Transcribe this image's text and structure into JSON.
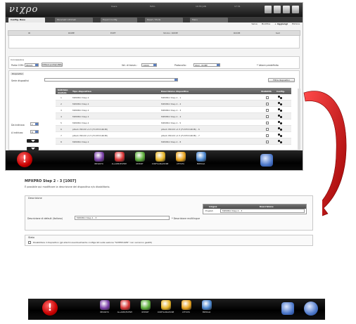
{
  "shot1": {
    "logo": "νιχρο",
    "top_info": [
      "Users",
      "Tutto",
      "19:55 JUN",
      "17:31"
    ],
    "tabs": [
      "Config. Base",
      "Parametri ottimali",
      "Export Config",
      "Reset / Mods",
      "Menu"
    ],
    "actions": [
      "Salva",
      "Modifica",
      "Aggiungi",
      "Elimina"
    ],
    "grid_head": [
      "ID",
      "ROME",
      "EXPT",
      "Strobo: ROME",
      "ROOM",
      "test"
    ],
    "connessione": {
      "title": "Connessione",
      "porta_com_label": "Porta COM:",
      "porta_com_value": "PROVA",
      "porta_button": "Ottieni porta(USB)",
      "vel_label": "Vel. di trasm.:",
      "vel_value": "19200",
      "protocollo_label": "Protocollo:",
      "protocollo_value": "IDAX - ROME",
      "hint": "* Valore predefinito"
    },
    "dispositivi": {
      "title": "Dispositivi",
      "serie_label": "Serie dispositivi",
      "filter_button": "Filtra dispositivi",
      "da_indirizzo_label": "Da indirizzo",
      "da_indirizzo_value": "1",
      "a_indirizzo_label": "A indirizzo",
      "a_indirizzo_value": "8",
      "headers": [
        "Indirizzo modulo",
        "Tipo dispositivo",
        "Descrizione dispositivo",
        "Visibilità",
        "Config."
      ],
      "rows": [
        {
          "addr": "1",
          "tipo": "MPXPRO Step 2",
          "desc": "MPXPRO Step 2 - 1"
        },
        {
          "addr": "2",
          "tipo": "MPXPRO Step 2",
          "desc": "MPXPRO Step 2 - 2"
        },
        {
          "addr": "3",
          "tipo": "MPXPRO Step 2",
          "desc": "MPXPRO Step 2 - 3"
        },
        {
          "addr": "4",
          "tipo": "MPXPRO Step 2",
          "desc": "MPXPRO Step 2 - 4"
        },
        {
          "addr": "5",
          "tipo": "MPXPRO Step 2",
          "desc": "MPXPRO Step 2 - 5"
        },
        {
          "addr": "6",
          "tipo": "pRack PR100 v1.5 (FLSTDmRCIB)",
          "desc": "pRack PR100 v1.5 (FLSTDmRCIB) - 6"
        },
        {
          "addr": "7",
          "tipo": "pRack PR100 v1.5 (FLSTDmRCIB)",
          "desc": "pRack PR100 v1.5 (FLSTDmRCIB) - 7"
        },
        {
          "addr": "8",
          "tipo": "MPXPRO Step 2",
          "desc": "MPXPRO Step 2 - 8"
        }
      ]
    },
    "dock": [
      "IMPIANTO",
      "ALLARMI/EVENTI",
      "REPORT",
      "CONFIGURAZIONE",
      "ATTIVITÀ",
      "ENERGIA"
    ],
    "alert_glyph": "!"
  },
  "shot2": {
    "title": "MPXPRO Step 2 - 3 [1007]",
    "subtitle": "È possibile qui modificare la descrizione del dispositivo e/o disabilitarlo.",
    "descrizione": {
      "legend": "Descrizione",
      "default_label": "Descrizione di default (Italiano)",
      "default_value": "MPXPRO Step 2 - 3",
      "multilingua_label": "* Descrizione multilingue",
      "table_headers": [
        "Lingua",
        "Descrizione"
      ],
      "table_row": {
        "lang": "English",
        "desc": "MPXPRO Step 2 - 3"
      }
    },
    "stato": {
      "legend": "Stato",
      "checkbox_label": "Disabilitare il dispositivo (gli allarmi eventualmente configurati sulla sezione \"SCHEDULER\" non verranno gestiti)"
    },
    "dock": [
      "IMPIANTO",
      "ALLARMI/EVENTI",
      "REPORT",
      "CONFIGURAZIONE",
      "ATTIVITÀ",
      "ENERGIA"
    ],
    "alert_glyph": "!"
  },
  "colors": {
    "arrow": "#d40d0d",
    "accent_blue": "#5b7fbf",
    "alert_red": "#c80000"
  }
}
